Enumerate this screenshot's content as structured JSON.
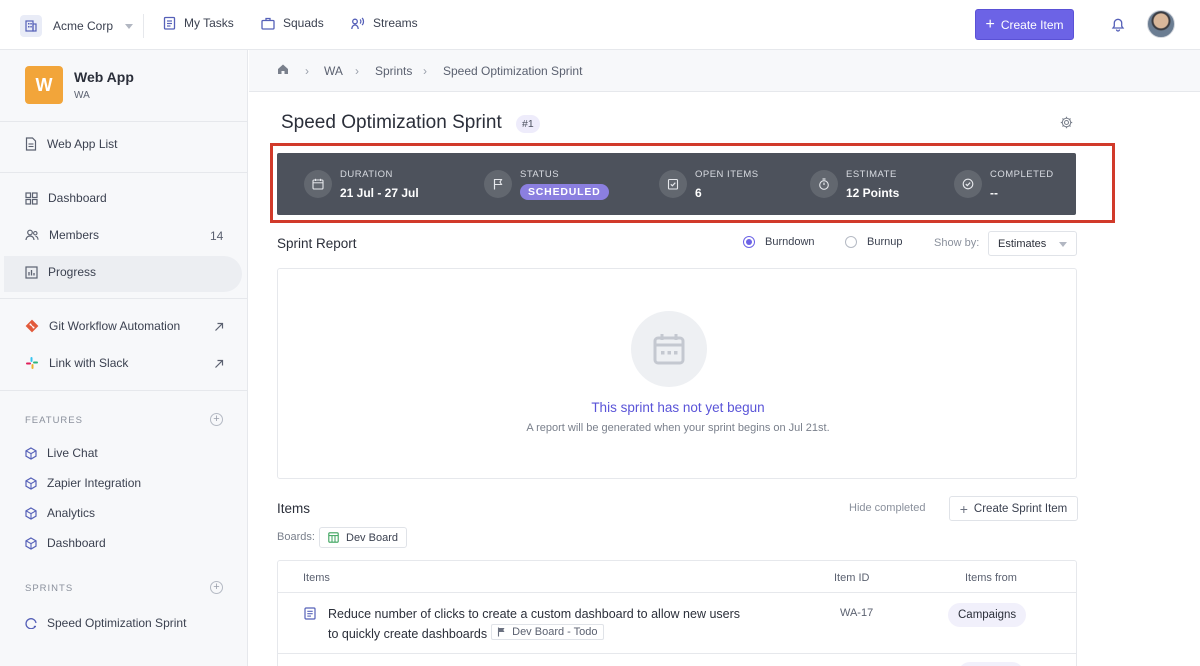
{
  "topbar": {
    "org_name": "Acme Corp",
    "nav": [
      {
        "label": "My Tasks",
        "icon": "tasks-icon"
      },
      {
        "label": "Squads",
        "icon": "briefcase-icon"
      },
      {
        "label": "Streams",
        "icon": "streams-icon"
      }
    ],
    "create_label": "Create Item"
  },
  "sidebar": {
    "app_initial": "W",
    "app_name": "Web App",
    "app_key": "WA",
    "list_label": "Web App List",
    "items": [
      {
        "label": "Dashboard"
      },
      {
        "label": "Members",
        "count": "14"
      },
      {
        "label": "Progress"
      }
    ],
    "integrations": [
      {
        "label": "Git Workflow Automation"
      },
      {
        "label": "Link with Slack"
      }
    ],
    "features_title": "FEATURES",
    "features": [
      {
        "label": "Live Chat"
      },
      {
        "label": "Zapier Integration"
      },
      {
        "label": "Analytics"
      },
      {
        "label": "Dashboard"
      }
    ],
    "sprints_title": "SPRINTS",
    "sprints": [
      {
        "label": "Speed Optimization Sprint"
      }
    ]
  },
  "breadcrumb": [
    "WA",
    "Sprints",
    "Speed Optimization Sprint"
  ],
  "sprint": {
    "title": "Speed Optimization Sprint",
    "number": "#1",
    "stats": {
      "duration_label": "DURATION",
      "duration_value": "21 Jul - 27 Jul",
      "status_label": "STATUS",
      "status_value": "SCHEDULED",
      "open_label": "OPEN ITEMS",
      "open_value": "6",
      "estimate_label": "ESTIMATE",
      "estimate_value": "12 Points",
      "completed_label": "COMPLETED",
      "completed_value": "--"
    }
  },
  "report": {
    "title": "Sprint Report",
    "burndown_label": "Burndown",
    "burnup_label": "Burnup",
    "selected": "Burndown",
    "showby_label": "Show by:",
    "showby_value": "Estimates",
    "empty_title": "This sprint has not yet begun",
    "empty_sub": "A report will be generated when your sprint begins on Jul 21st."
  },
  "items": {
    "title": "Items",
    "hide_completed": "Hide completed",
    "create_label": "Create Sprint Item",
    "boards_label": "Boards:",
    "board": "Dev Board",
    "columns": {
      "items": "Items",
      "id": "Item ID",
      "from": "Items from"
    },
    "rows": [
      {
        "title": "Reduce number of clicks to create a custom dashboard to allow new users to quickly create dashboards",
        "board_status": "Dev Board - Todo",
        "id": "WA-17",
        "from": "Campaigns"
      }
    ]
  },
  "colors": {
    "accent": "#6c63e6",
    "app_tile": "#f2a53a",
    "stats_bg": "#4d525c",
    "highlight": "#d13a2a",
    "status_badge": "#8b7fe0"
  }
}
